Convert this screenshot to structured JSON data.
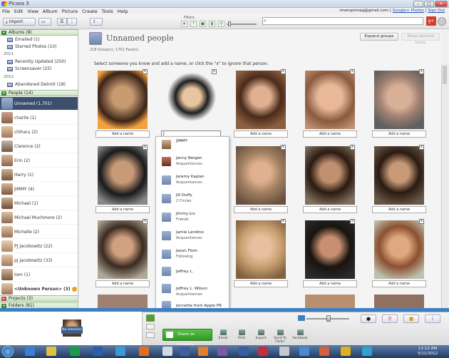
{
  "window": {
    "title": "Picasa 3"
  },
  "menu": [
    "File",
    "Edit",
    "View",
    "Album",
    "Picture",
    "Create",
    "Tools",
    "Help"
  ],
  "account": {
    "email": "mvenpomag@gmail.com",
    "photos_link": "Google+ Photos",
    "signout": "Sign Out"
  },
  "toolbar": {
    "import_label": "Import",
    "filters_label": "Filters",
    "search_placeholder": ""
  },
  "sidebar": {
    "albums_header": "Albums (8)",
    "albums_top": [
      {
        "label": "Emailed (1)"
      },
      {
        "label": "Starred Photos (10)"
      }
    ],
    "year_2011": "2011",
    "albums_2011": [
      {
        "label": "Recently Updated (250)"
      },
      {
        "label": "Screensaver (25)"
      }
    ],
    "year_2012": "2012",
    "albums_2012": [
      {
        "label": "Abandoned Detroit (18)"
      }
    ],
    "people_header": "People (14)",
    "people": [
      {
        "label": "Unnamed (1,701)"
      },
      {
        "label": "charlie (1)"
      },
      {
        "label": "chiharu (2)"
      },
      {
        "label": "Clarence (2)"
      },
      {
        "label": "Erin (2)"
      },
      {
        "label": "Harry (1)"
      },
      {
        "label": "JIMMY (4)"
      },
      {
        "label": "Michael (1)"
      },
      {
        "label": "Michael Muchmore (2)"
      },
      {
        "label": "Michelle (2)"
      },
      {
        "label": "PJ Jacobowitz (22)"
      },
      {
        "label": "pj jacobowitz (33)"
      },
      {
        "label": "tom (1)"
      },
      {
        "label": "<Unknown Person> (3)"
      }
    ],
    "projects_header": "Projects (3)",
    "folders_header": "Folders (81)"
  },
  "main": {
    "title": "Unnamed people",
    "count": "218 Group(s), 1701 Face(s)",
    "expand_label": "Expand groups",
    "ignored_label": "Show ignored faces",
    "instructions": "Select someone you know and add a name, or click the \"x\" to ignore that person.",
    "add_name": "Add a name",
    "close_x": "x"
  },
  "dropdown": {
    "input_value": "J",
    "items": [
      {
        "name": "JIMMY",
        "sub": ""
      },
      {
        "name": "Jenny Bergen",
        "sub": "Acquaintances"
      },
      {
        "name": "Jeremy Kaplan",
        "sub": "Acquaintances"
      },
      {
        "name": "Jill Duffy",
        "sub": "2 Circles"
      },
      {
        "name": "Jimmy Liu",
        "sub": "Friends"
      },
      {
        "name": "Jamie Lendino",
        "sub": "Acquaintances"
      },
      {
        "name": "Jason Flom",
        "sub": "Following"
      },
      {
        "name": "Jeffrey L.",
        "sub": ""
      },
      {
        "name": "Jeffrey L. Wilson",
        "sub": "Acquaintances"
      },
      {
        "name": "Jennette from Apple PR",
        "sub": ""
      }
    ]
  },
  "tray": {
    "no_selection": "No selection",
    "share_label": "Share on Google+",
    "actions": [
      {
        "label": "Email"
      },
      {
        "label": "Print"
      },
      {
        "label": "Export"
      },
      {
        "label": "Send To Flickr!"
      },
      {
        "label": "Facebook"
      }
    ]
  },
  "taskbar": {
    "time": "11:12 AM",
    "date": "5/11/2012"
  },
  "colors": {
    "accent": "#3a80c4",
    "selected_row": "#3d4f6f",
    "share_green": "#2e9a22"
  }
}
